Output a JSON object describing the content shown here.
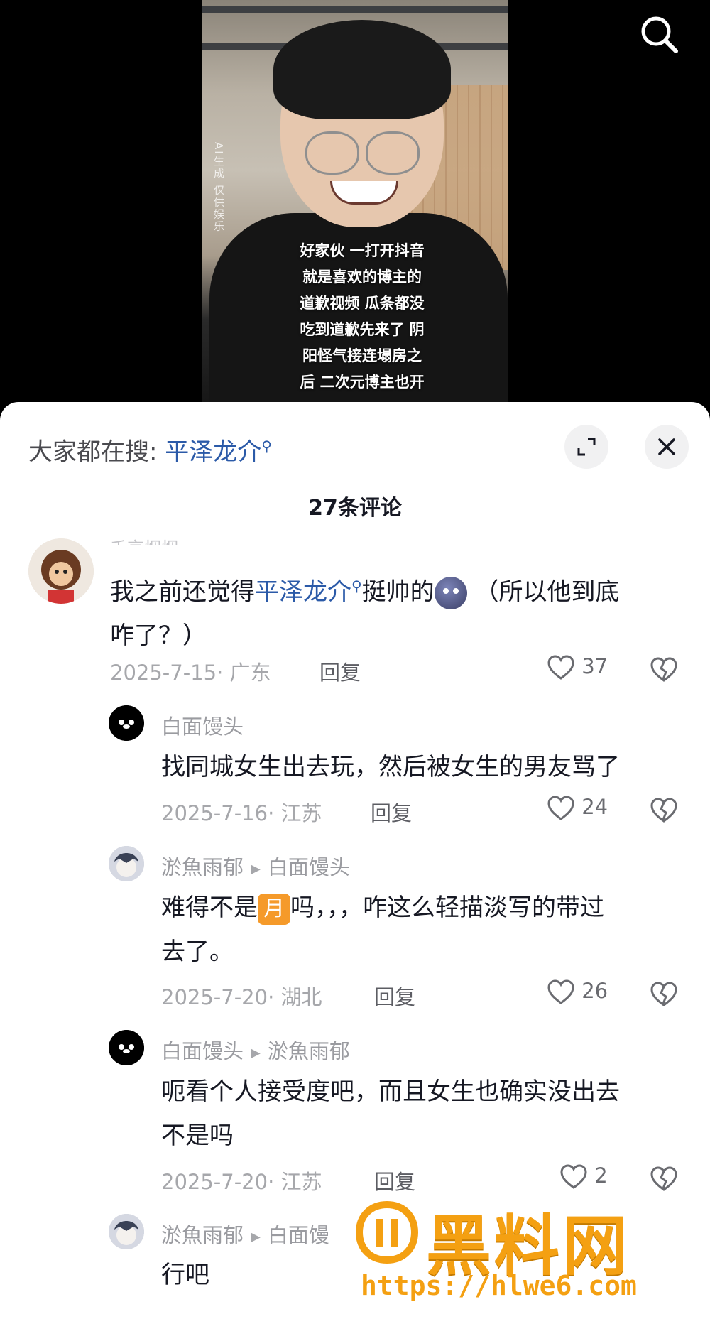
{
  "video": {
    "ai_label": "AI生成  仅供娱乐",
    "subtitle": "好家伙 一打开抖音\n就是喜欢的博主的\n道歉视频 瓜条都没\n吃到道歉先来了 阴\n阳怪气接连塌房之\n后 二次元博主也开"
  },
  "header": {
    "search_icon": "search-icon"
  },
  "sheet": {
    "hot_search_prefix": "大家都在搜:",
    "hot_search_keyword": "平泽龙介",
    "comment_count": "27条评论"
  },
  "comments": [
    {
      "username": "千京烟烟",
      "text_before": "我之前还觉得",
      "keyword": "平泽龙介",
      "text_after": "挺帅的",
      "text_tail": "（所以他到底",
      "text_line2": "咋了？）",
      "date": "2025-7-15",
      "location": "广东",
      "reply_label": "回复",
      "likes": "37"
    },
    {
      "username": "白面馒头",
      "text": "找同城女生出去玩，然后被女生的男友骂了",
      "date": "2025-7-16",
      "location": "江苏",
      "reply_label": "回复",
      "likes": "24"
    },
    {
      "username": "淤魚雨郁",
      "reply_to": "白面馒头",
      "text_before": "难得不是",
      "badge": "月",
      "text_after": "吗，，，咋这么轻描淡写的带过",
      "text_line2": "去了。",
      "date": "2025-7-20",
      "location": "湖北",
      "reply_label": "回复",
      "likes": "26"
    },
    {
      "username": "白面馒头",
      "reply_to": "淤魚雨郁",
      "text": "呃看个人接受度吧，而且女生也确实没出去",
      "text_line2": "不是吗",
      "date": "2025-7-20",
      "location": "江苏",
      "reply_label": "回复",
      "likes": "2"
    },
    {
      "username": "淤魚雨郁",
      "reply_to": "白面馒",
      "text": "行吧"
    }
  ],
  "watermark": {
    "title": "黑料网",
    "url": "https://hlwe6.com"
  }
}
